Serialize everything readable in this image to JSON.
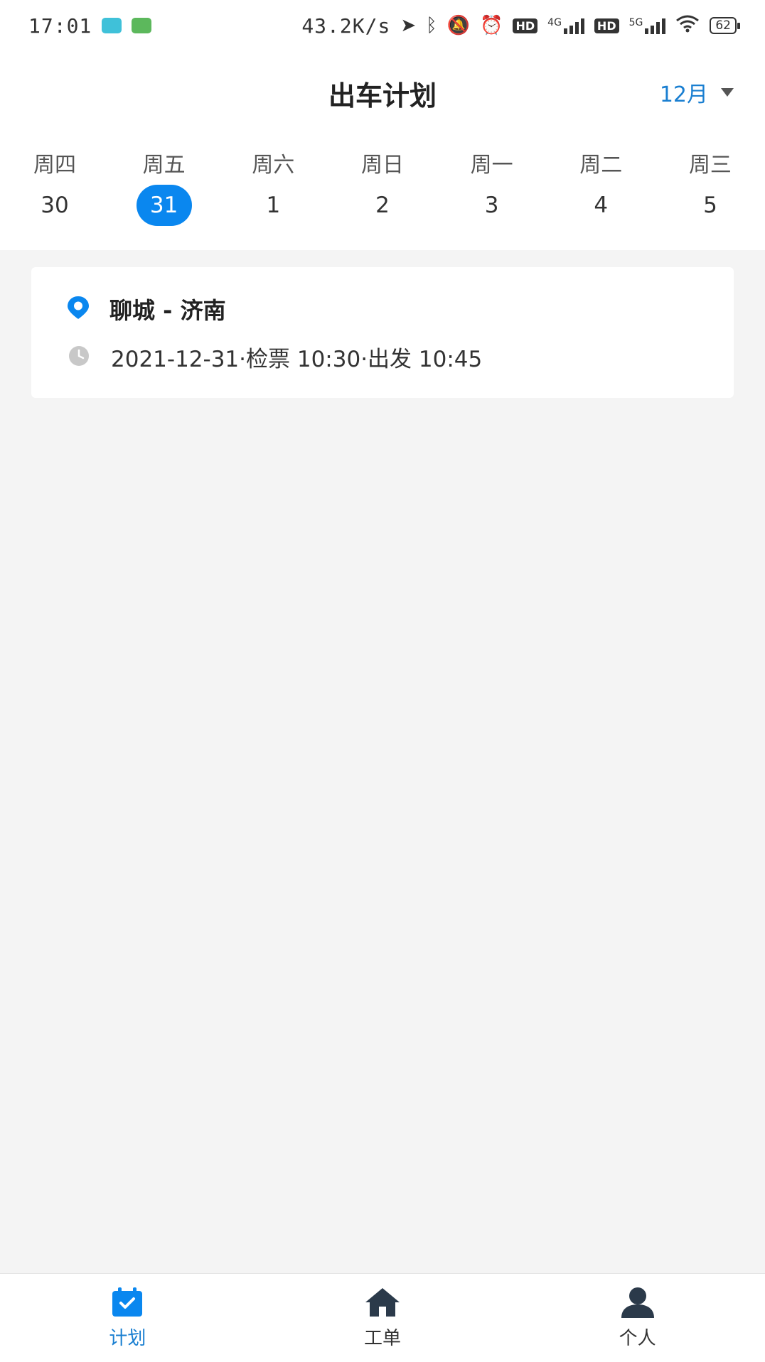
{
  "status_bar": {
    "time": "17:01",
    "net_speed": "43.2K/s",
    "sig1_label": "4G",
    "sig2_label": "5G",
    "hd": "HD",
    "battery": "62"
  },
  "header": {
    "title": "出车计划",
    "month": "12月"
  },
  "week": [
    {
      "name": "周四",
      "date": "30"
    },
    {
      "name": "周五",
      "date": "31",
      "selected": true
    },
    {
      "name": "周六",
      "date": "1"
    },
    {
      "name": "周日",
      "date": "2"
    },
    {
      "name": "周一",
      "date": "3"
    },
    {
      "name": "周二",
      "date": "4"
    },
    {
      "name": "周三",
      "date": "5"
    }
  ],
  "trip": {
    "route": "聊城 - 济南",
    "time": "2021-12-31·检票 10:30·出发 10:45"
  },
  "tabs": [
    {
      "label": "计划",
      "icon": "calendar-check-icon",
      "active": true
    },
    {
      "label": "工单",
      "icon": "home-icon"
    },
    {
      "label": "个人",
      "icon": "person-icon"
    }
  ],
  "colors": {
    "accent": "#0a87ef",
    "month_text": "#1a7fd1",
    "background": "#f4f4f4",
    "pin": "#0a87ef",
    "clock": "#c8c8c8",
    "tab_icon_inactive": "#2b3a4a"
  }
}
